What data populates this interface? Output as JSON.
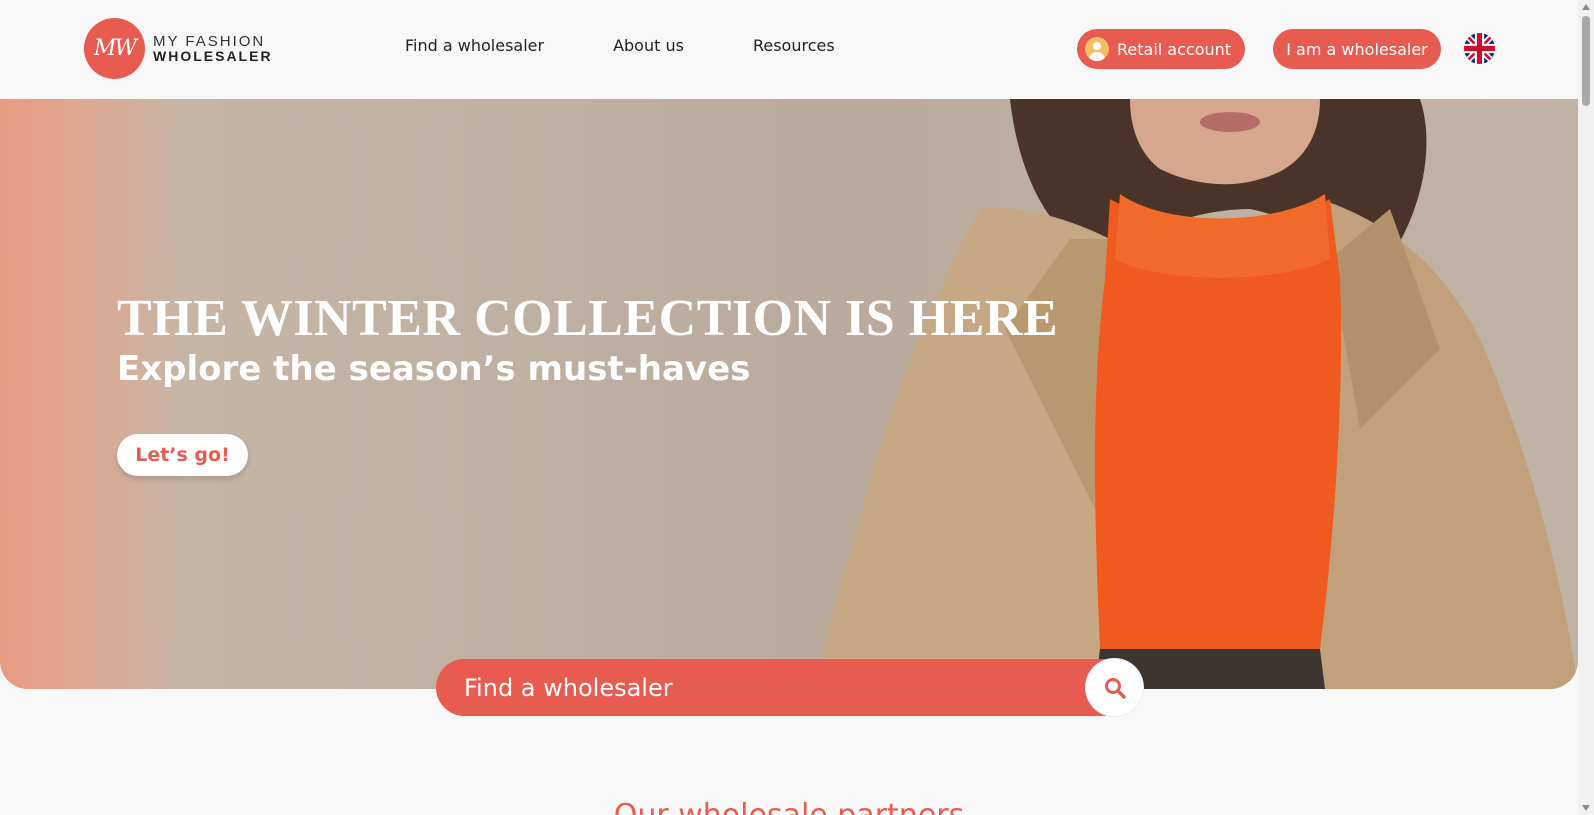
{
  "header": {
    "logo": {
      "initials": "MW",
      "line1": "MY FASHION",
      "line2": "WHOLESALER"
    },
    "nav": [
      "Find a wholesaler",
      "About us",
      "Resources"
    ],
    "retail_account_label": "Retail account",
    "wholesaler_label": "I am a wholesaler",
    "language_icon": "uk-flag-icon"
  },
  "hero": {
    "title": "THE WINTER COLLECTION IS HERE",
    "subtitle": "Explore the season’s must-haves",
    "cta_label": "Let’s go!"
  },
  "search": {
    "placeholder": "Find a wholesaler",
    "icon": "search-icon"
  },
  "partners_heading": "Our wholesale partners",
  "colors": {
    "accent": "#e85b50",
    "background": "#f8f8f8"
  }
}
